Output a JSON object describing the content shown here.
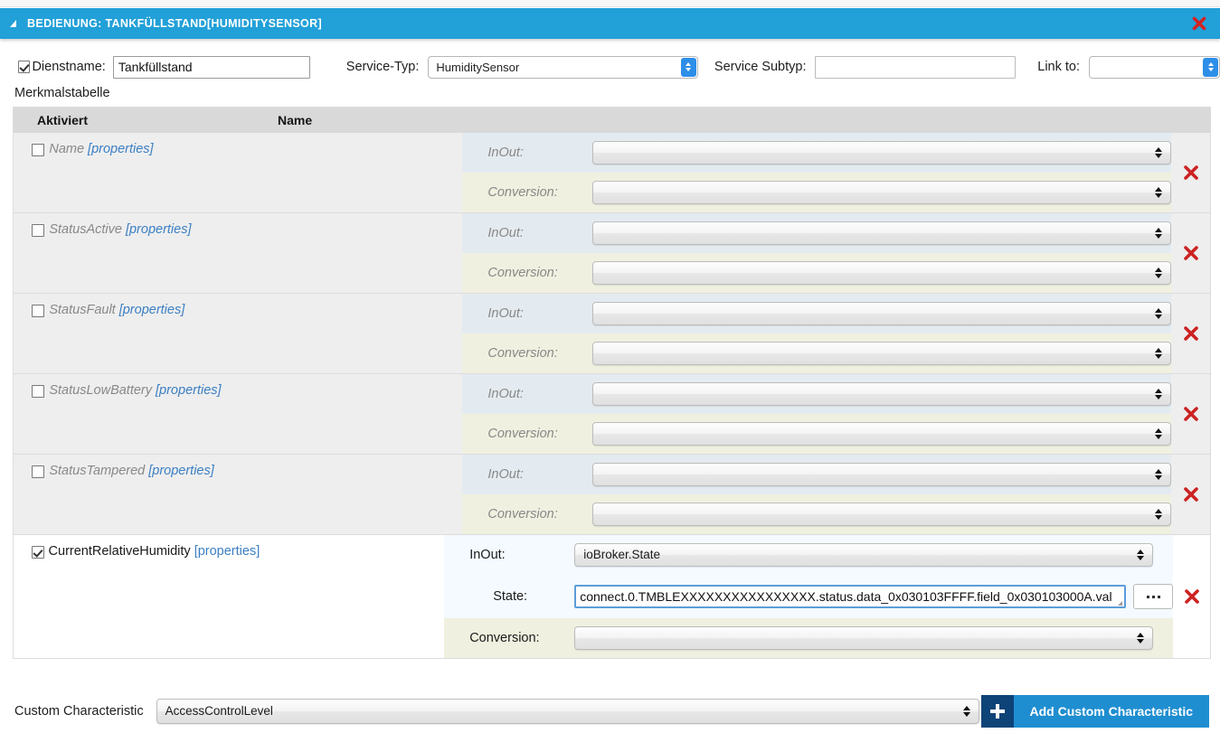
{
  "panel": {
    "title": "BEDIENUNG: TANKFÜLLSTAND[HUMIDITYSENSOR]",
    "close_icon": "close-x-icon",
    "collapse_icon": "collapse-caret-icon",
    "header_color": "#22a0d8"
  },
  "form": {
    "servicename_label": "Dienstname:",
    "servicename_value": "Tankfüllstand",
    "servicename_checked": true,
    "servicetype_label": "Service-Typ:",
    "servicetype_value": "HumiditySensor",
    "servicesubtype_label": "Service Subtyp:",
    "servicesubtype_value": "",
    "linkto_label": "Link to:",
    "linkto_value": ""
  },
  "table": {
    "caption": "Merkmalstabelle",
    "headers": {
      "enabled": "Aktiviert",
      "name": "Name"
    },
    "labels": {
      "inout": "InOut:",
      "conversion": "Conversion:",
      "state": "State:",
      "properties": "[properties]",
      "delete_icon": "delete-x-icon",
      "browse_button": "...",
      "resize_handle": "resize-grip-icon"
    },
    "rows": [
      {
        "name": "Name",
        "enabled": false,
        "inout_value": "",
        "conversion_value": "",
        "has_state": false
      },
      {
        "name": "StatusActive",
        "enabled": false,
        "inout_value": "",
        "conversion_value": "",
        "has_state": false
      },
      {
        "name": "StatusFault",
        "enabled": false,
        "inout_value": "",
        "conversion_value": "",
        "has_state": false
      },
      {
        "name": "StatusLowBattery",
        "enabled": false,
        "inout_value": "",
        "conversion_value": "",
        "has_state": false
      },
      {
        "name": "StatusTampered",
        "enabled": false,
        "inout_value": "",
        "conversion_value": "",
        "has_state": false
      },
      {
        "name": "CurrentRelativeHumidity",
        "enabled": true,
        "inout_value": "ioBroker.State",
        "state_value": "connect.0.TMBLEXXXXXXXXXXXXXXXX.status.data_0x030103FFFF.field_0x030103000A.val",
        "conversion_value": "",
        "has_state": true
      }
    ]
  },
  "footer": {
    "custom_characteristic_label": "Custom Characteristic",
    "custom_characteristic_value": "AccessControlLevel",
    "add_button_label": "Add Custom Characteristic",
    "add_button_icon": "plus-icon",
    "add_button_color": "#1f8ed0",
    "add_button_icon_bg": "#0e4377"
  }
}
